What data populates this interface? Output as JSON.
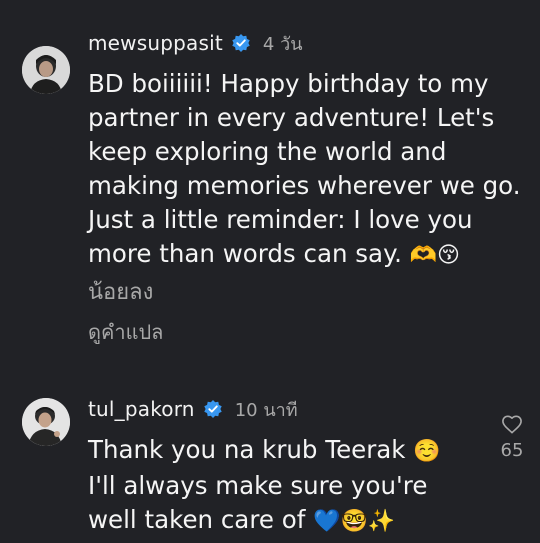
{
  "comments": [
    {
      "username": "mewsuppasit",
      "time": "4 วัน",
      "body_lines": [
        "BD boiiiiii! Happy birthday to my",
        "partner in every adventure! Let's",
        "keep exploring the world and",
        "making memories wherever we go.",
        "Just a little reminder: I love you",
        "more than words can say."
      ],
      "body_emoji": "🫶😚",
      "see_less": "น้อยลง",
      "translate": "ดูคำแปล"
    },
    {
      "username": "tul_pakorn",
      "time": "10 นาที",
      "body_lines": [
        "Thank you na krub Teerak",
        "I'll always make sure you're",
        "well taken care of"
      ],
      "line1_emoji": "☺️",
      "line3_emoji": "💙🤓✨",
      "like_count": "65"
    }
  ],
  "colors": {
    "background": "#212226",
    "primary_text": "#f5f5f5",
    "secondary_text": "#a8a8a8",
    "verified_badge": "#3897f0"
  },
  "icons": [
    "verified-badge-icon",
    "heart-outline-icon"
  ]
}
